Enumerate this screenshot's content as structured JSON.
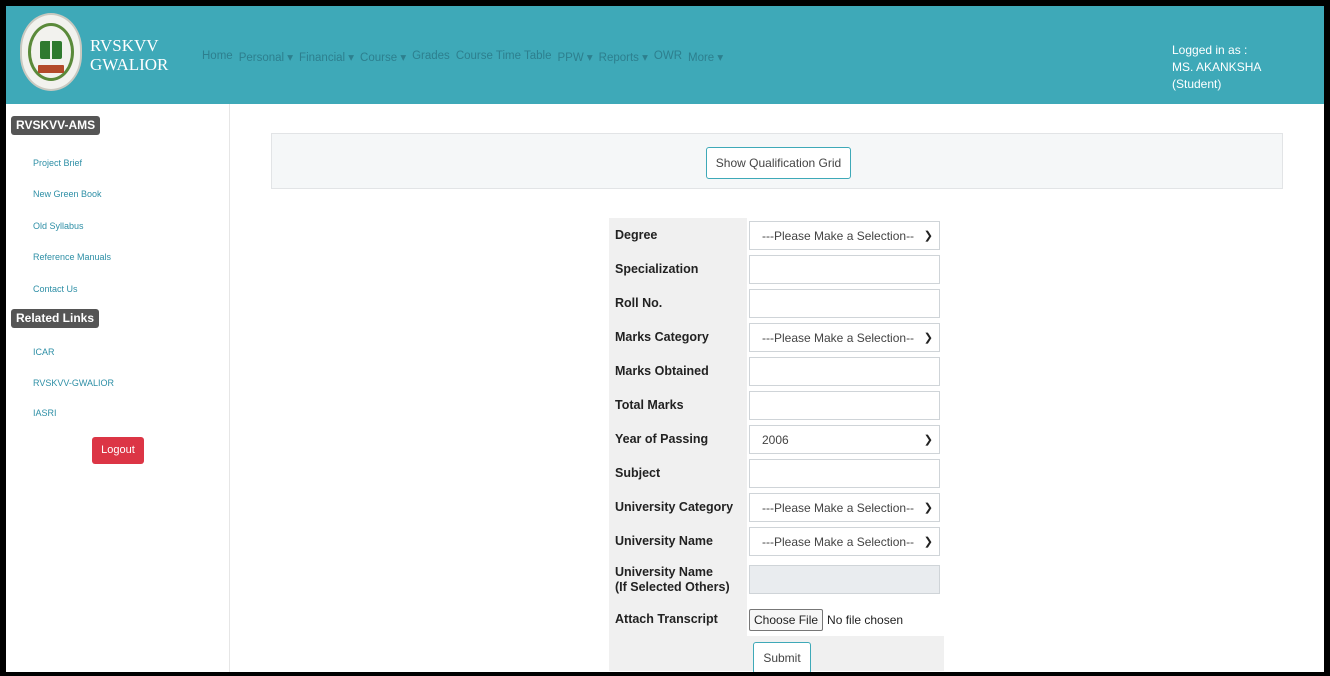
{
  "brand": {
    "line1": "RVSKVV",
    "line2": "GWALIOR"
  },
  "nav": {
    "items": [
      "Home",
      "Personal ▾",
      "Financial ▾",
      "Course ▾",
      "Grades",
      "Course Time Table",
      "PPW ▾",
      "Reports ▾",
      "OWR",
      "More ▾"
    ]
  },
  "login": {
    "label": "Logged in as :",
    "user": "MS. AKANKSHA (Student)"
  },
  "sidebar": {
    "section1": "RVSKVV-AMS",
    "links1": [
      "Project Brief",
      "New Green Book",
      "Old Syllabus",
      "Reference Manuals",
      "Contact Us"
    ],
    "section2": "Related Links",
    "links2": [
      "ICAR",
      "RVSKVV-GWALIOR",
      "IASRI"
    ],
    "logout": "Logout"
  },
  "grid_button": "Show Qualification Grid",
  "form": {
    "rows": [
      {
        "label": "Degree",
        "type": "select",
        "value": "---Please Make a Selection--"
      },
      {
        "label": "Specialization",
        "type": "text",
        "value": ""
      },
      {
        "label": "Roll No.",
        "type": "text",
        "value": ""
      },
      {
        "label": "Marks Category",
        "type": "select",
        "value": "---Please Make a Selection--"
      },
      {
        "label": "Marks Obtained",
        "type": "text",
        "value": ""
      },
      {
        "label": "Total Marks",
        "type": "text",
        "value": ""
      },
      {
        "label": "Year of Passing",
        "type": "select",
        "value": "2006"
      },
      {
        "label": "Subject",
        "type": "text",
        "value": ""
      },
      {
        "label": "University Category",
        "type": "select",
        "value": "---Please Make a Selection--"
      },
      {
        "label": "University Name",
        "type": "select",
        "value": "---Please Make a Selection--"
      },
      {
        "label": "University Name\n(If Selected Others)",
        "type": "disabled",
        "value": ""
      },
      {
        "label": "Attach Transcript",
        "type": "file",
        "button": "Choose File",
        "value": "No file chosen"
      }
    ],
    "submit": "Submit"
  }
}
